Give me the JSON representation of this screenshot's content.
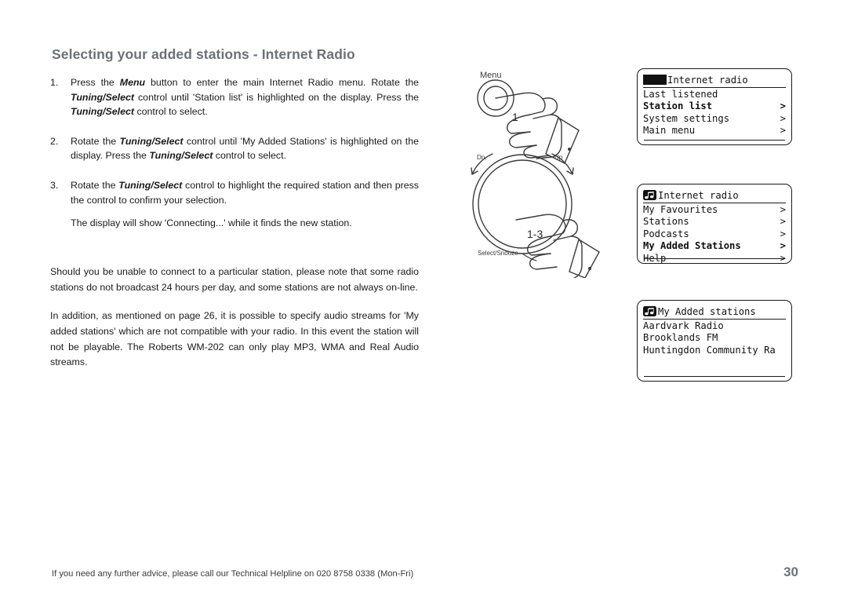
{
  "title": "Selecting your added stations - Internet Radio",
  "steps": [
    {
      "num": "1.",
      "parts": [
        {
          "t": "Press the ",
          "b": false
        },
        {
          "t": "Menu",
          "b": true
        },
        {
          "t": " button to enter the main Internet Radio menu. Rotate the ",
          "b": false
        },
        {
          "t": "Tuning/Select",
          "b": true
        },
        {
          "t": " control until 'Station list' is highlighted on the display. Press the ",
          "b": false
        },
        {
          "t": "Tuning/Select",
          "b": true
        },
        {
          "t": " control to select.",
          "b": false
        }
      ],
      "extra": null
    },
    {
      "num": "2.",
      "parts": [
        {
          "t": "Rotate the ",
          "b": false
        },
        {
          "t": "Tuning/Select",
          "b": true
        },
        {
          "t": " control until 'My Added Stations' is highlighted on the display. Press the ",
          "b": false
        },
        {
          "t": "Tuning/Select",
          "b": true
        },
        {
          "t": " control to select.",
          "b": false
        }
      ],
      "extra": null
    },
    {
      "num": "3.",
      "parts": [
        {
          "t": "Rotate the ",
          "b": false
        },
        {
          "t": "Tuning/Select",
          "b": true
        },
        {
          "t": " control to highlight the required station and then press the control to confirm your selection.",
          "b": false
        }
      ],
      "extra": "The display will show 'Connecting...' while it finds the new station."
    }
  ],
  "paragraphs": [
    "Should you be unable to connect to a particular station, please note that some radio stations do not broadcast 24 hours per day, and some stations are not always on-line.",
    "In addition, as mentioned on page 26, it is possible to specify audio streams for 'My added stations' which are not compatible with your radio. In this event the station will not be playable. The Roberts WM-202 can only play MP3, WMA and Real Audio streams."
  ],
  "illustration": {
    "menu_label": "Menu",
    "menu_hand_number": "1",
    "dial_down_label": "Dn.",
    "dial_up_label": "Up",
    "dial_select_label": "Select/Snooze",
    "dial_hand_number": "1-3"
  },
  "displays": [
    {
      "header": "Internet radio",
      "header_icon": "block-cursor-icon",
      "rows": [
        {
          "label": "Last listened",
          "chevron": "",
          "bold": false
        },
        {
          "label": "Station list",
          "chevron": ">",
          "bold": true
        },
        {
          "label": "System settings",
          "chevron": ">",
          "bold": false
        },
        {
          "label": "Main menu",
          "chevron": ">",
          "bold": false
        }
      ]
    },
    {
      "header": "Internet radio",
      "header_icon": "music-note-icon",
      "rows": [
        {
          "label": "My Favourites",
          "chevron": ">",
          "bold": false
        },
        {
          "label": "Stations",
          "chevron": ">",
          "bold": false
        },
        {
          "label": "Podcasts",
          "chevron": ">",
          "bold": false
        },
        {
          "label": "My Added Stations",
          "chevron": ">",
          "bold": true
        },
        {
          "label": "Help",
          "chevron": ">",
          "bold": false
        }
      ]
    },
    {
      "header": "My Added stations",
      "header_icon": "music-note-icon",
      "rows": [
        {
          "label": "Aardvark Radio",
          "chevron": "",
          "bold": false
        },
        {
          "label": "Brooklands FM",
          "chevron": "",
          "bold": false
        },
        {
          "label": "Huntingdon Community Ra",
          "chevron": "",
          "bold": false
        }
      ]
    }
  ],
  "footer": {
    "helpline": "If you need any further advice, please call our Technical Helpline on 020 8758 0338 (Mon-Fri)",
    "page_number": "30"
  }
}
